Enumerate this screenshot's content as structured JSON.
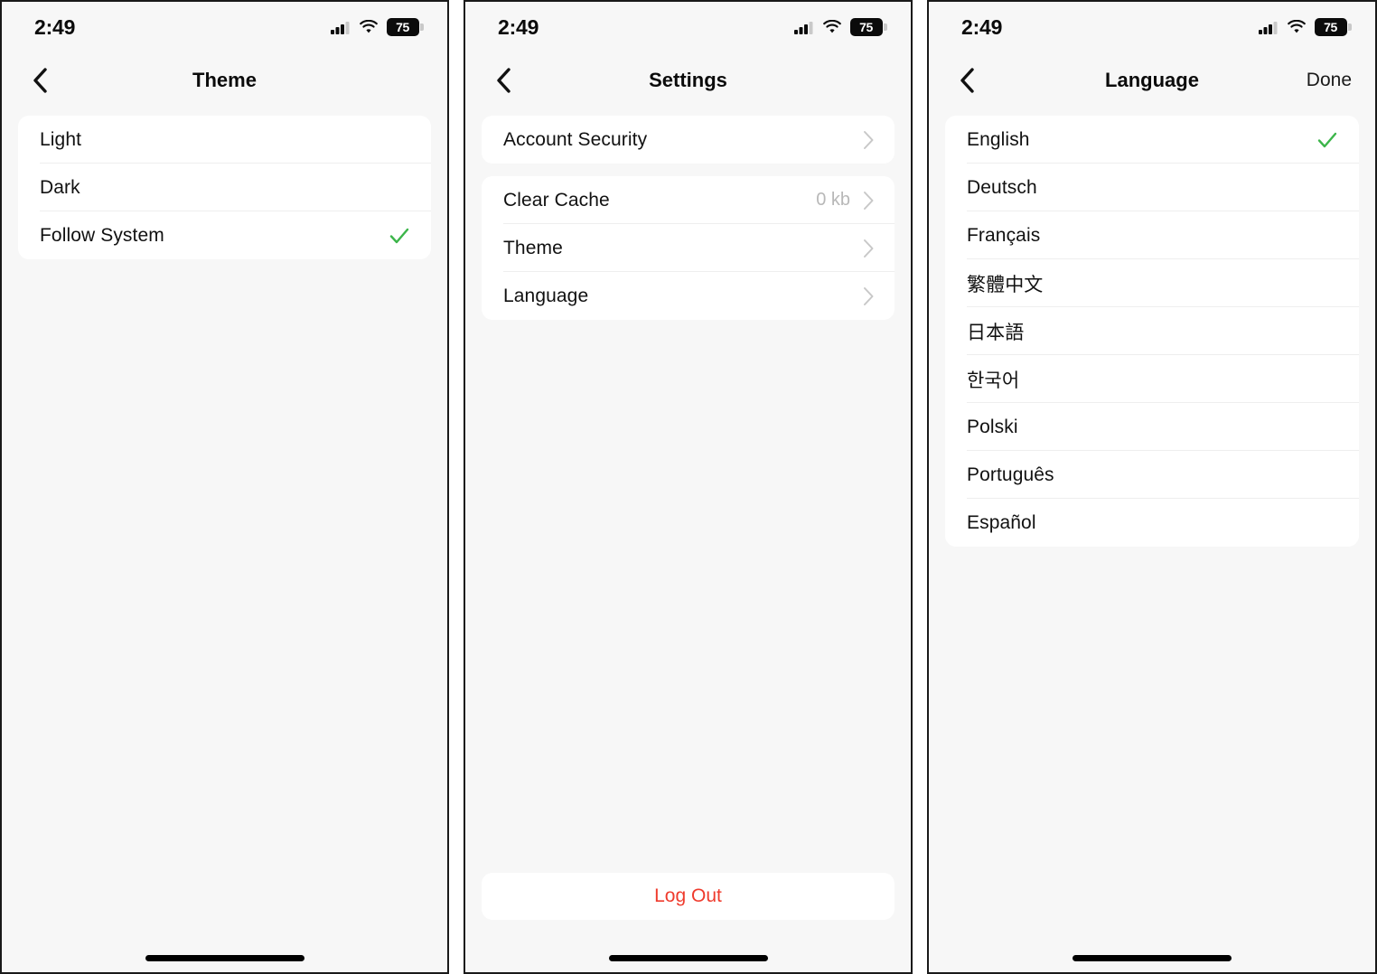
{
  "status_bar": {
    "time": "2:49",
    "cellular_icon": "cellular-signal-icon",
    "wifi_icon": "wifi-icon",
    "battery_icon": "battery-icon",
    "battery_level": "75"
  },
  "colors": {
    "page_background": "#f7f7f7",
    "card_background": "#ffffff",
    "primary_text": "#111111",
    "secondary_text": "#b8b8b8",
    "check_green": "#3cb54a",
    "logout_red": "#ef3b2d",
    "separator": "#eeeeee"
  },
  "screens": [
    {
      "id": "theme",
      "nav": {
        "back_icon": "chevron-left-icon",
        "title": "Theme",
        "action": ""
      },
      "cards": [
        {
          "rows": [
            {
              "label": "Light",
              "value": "",
              "accessory": "none"
            },
            {
              "label": "Dark",
              "value": "",
              "accessory": "none"
            },
            {
              "label": "Follow System",
              "value": "",
              "accessory": "check"
            }
          ]
        }
      ]
    },
    {
      "id": "settings",
      "nav": {
        "back_icon": "chevron-left-icon",
        "title": "Settings",
        "action": ""
      },
      "cards": [
        {
          "rows": [
            {
              "label": "Account Security",
              "value": "",
              "accessory": "chevron"
            }
          ]
        },
        {
          "rows": [
            {
              "label": "Clear Cache",
              "value": "0 kb",
              "accessory": "chevron"
            },
            {
              "label": "Theme",
              "value": "",
              "accessory": "chevron"
            },
            {
              "label": "Language",
              "value": "",
              "accessory": "chevron"
            }
          ]
        }
      ],
      "logout": {
        "label": "Log Out"
      }
    },
    {
      "id": "language",
      "nav": {
        "back_icon": "chevron-left-icon",
        "title": "Language",
        "action": "Done"
      },
      "cards": [
        {
          "rows": [
            {
              "label": "English",
              "value": "",
              "accessory": "check"
            },
            {
              "label": "Deutsch",
              "value": "",
              "accessory": "none"
            },
            {
              "label": "Français",
              "value": "",
              "accessory": "none"
            },
            {
              "label": "繁體中文",
              "value": "",
              "accessory": "none"
            },
            {
              "label": "日本語",
              "value": "",
              "accessory": "none"
            },
            {
              "label": "한국어",
              "value": "",
              "accessory": "none"
            },
            {
              "label": "Polski",
              "value": "",
              "accessory": "none"
            },
            {
              "label": "Português",
              "value": "",
              "accessory": "none"
            },
            {
              "label": "Español",
              "value": "",
              "accessory": "none"
            }
          ]
        }
      ]
    }
  ]
}
